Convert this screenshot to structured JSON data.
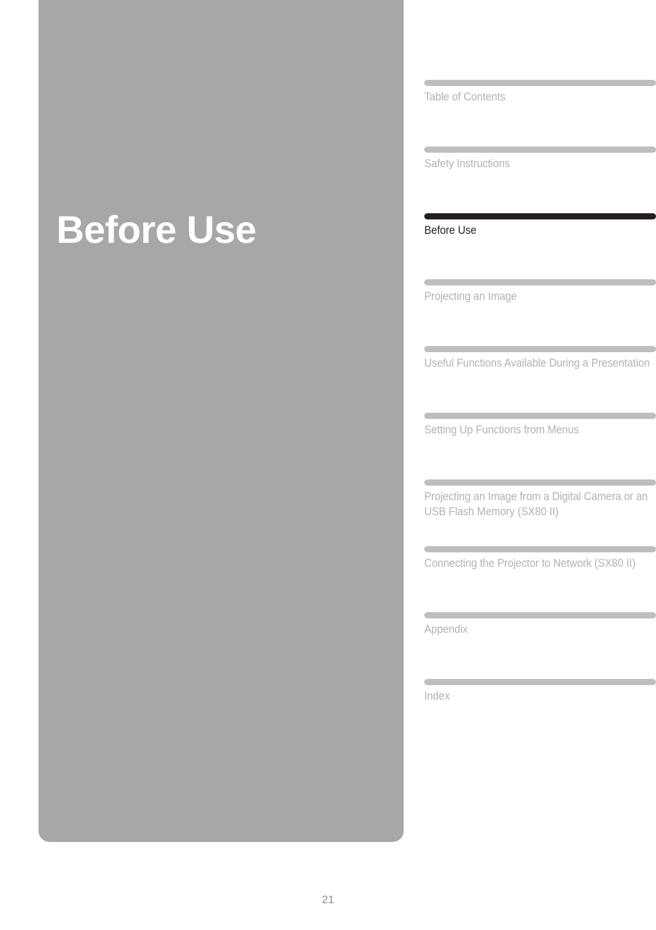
{
  "chapter": {
    "title": "Before Use"
  },
  "index": {
    "items": [
      {
        "label": "Table of Contents",
        "active": false
      },
      {
        "label": "Safety Instructions",
        "active": false
      },
      {
        "label": "Before Use",
        "active": true
      },
      {
        "label": "Projecting an Image",
        "active": false
      },
      {
        "label": "Useful Functions Available During a Presentation",
        "active": false
      },
      {
        "label": "Setting Up Functions from Menus",
        "active": false
      },
      {
        "label": "Projecting an Image from a Digital Camera or an USB Flash Memory (SX80 II)",
        "active": false
      },
      {
        "label": "Connecting the Projector to Network (SX80 II)",
        "active": false
      },
      {
        "label": "Appendix",
        "active": false
      },
      {
        "label": "Index",
        "active": false
      }
    ]
  },
  "footer": {
    "page_number": "21"
  },
  "colors": {
    "panel_gray": "#a7a7a7",
    "bar_gray": "#bcbec0",
    "bar_active": "#231f20",
    "label_gray": "#b0b2b4",
    "label_active": "#231f20",
    "page_number_gray": "#8b8d8f",
    "title_white": "#ffffff",
    "page_background": "#ffffff"
  }
}
